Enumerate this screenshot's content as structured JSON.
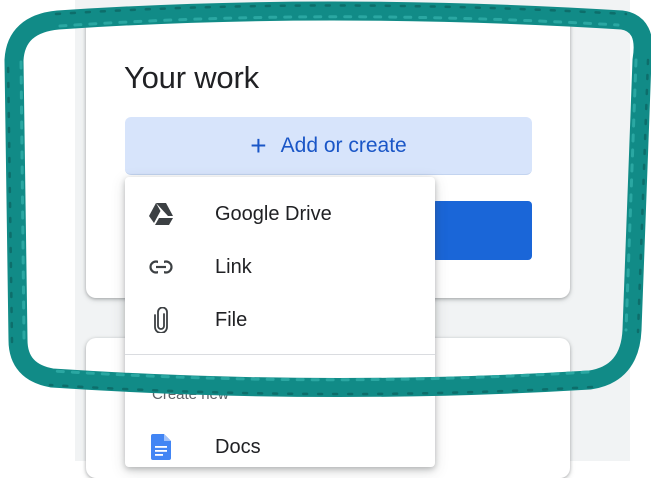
{
  "work": {
    "title": "Your work",
    "add_button": {
      "icon": "plus-icon",
      "label": "Add or create"
    }
  },
  "menu": {
    "items": [
      {
        "icon": "google-drive-icon",
        "label": "Google Drive"
      },
      {
        "icon": "link-icon",
        "label": "Link"
      },
      {
        "icon": "paperclip-icon",
        "label": "File"
      }
    ],
    "section_label": "Create new",
    "create_items": [
      {
        "icon": "docs-icon",
        "label": "Docs"
      }
    ]
  },
  "colors": {
    "accent": "#1a66d8",
    "add_button_bg": "#d7e4fb",
    "highlight_frame": "#118b87",
    "docs_blue": "#4285f4"
  }
}
